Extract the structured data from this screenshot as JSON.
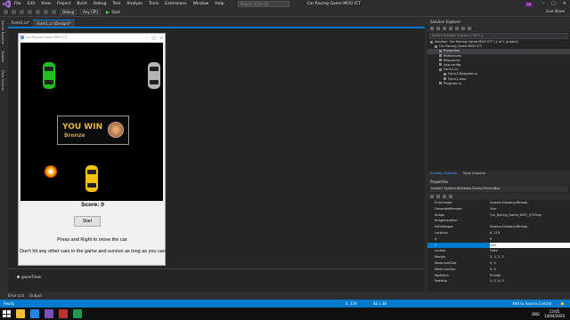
{
  "menu": {
    "items": [
      "File",
      "Edit",
      "View",
      "Project",
      "Build",
      "Debug",
      "Test",
      "Analyze",
      "Tools",
      "Extensions",
      "Window",
      "Help"
    ],
    "search_placeholder": "Search (Ctrl+Q)",
    "project_title": "Car Racing Game MOO ICT",
    "account_badge": "AA"
  },
  "toolbar": {
    "config": "Debug",
    "platform": "Any CPU",
    "start_label": "Start",
    "live_share": "Live Share"
  },
  "left_tabs": [
    "Server Explorer",
    "Toolbox",
    "Data Sources"
  ],
  "doc_tabs": [
    "Form1.cs*",
    "Form1.cs [Design]*"
  ],
  "form": {
    "title": "Car Racing Game MOO ICT",
    "win_text": "YOU WIN",
    "win_sub": "Bronze",
    "score": "Score: 0",
    "start_button": "Start",
    "instr1": "Press and Right to move the car.",
    "instr2": "Don't hit any other cars in the game and survive as long as you can"
  },
  "component_tray": {
    "timer": "gameTimer"
  },
  "solution_explorer": {
    "title": "Solution Explorer",
    "search_placeholder": "Search Solution Explorer (Ctrl+;)",
    "tree": [
      {
        "label": "Solution 'Car Racing Game MOO ICT' (1 of 1 project)",
        "indent": 0
      },
      {
        "label": "Car Racing Game MOO ICT",
        "indent": 1
      },
      {
        "label": "Properties",
        "indent": 2,
        "selected": true
      },
      {
        "label": "References",
        "indent": 2
      },
      {
        "label": "Resources",
        "indent": 2
      },
      {
        "label": "App.config",
        "indent": 2
      },
      {
        "label": "Form1.cs",
        "indent": 2
      },
      {
        "label": "Form1.Designer.cs",
        "indent": 3
      },
      {
        "label": "Form1.resx",
        "indent": 3
      },
      {
        "label": "Program.cs",
        "indent": 2
      }
    ],
    "tabs": [
      "Solution Explorer",
      "Team Explorer"
    ]
  },
  "properties": {
    "title": "Properties",
    "object": "medal2 System.Windows.Forms.PictureBox",
    "rows": [
      {
        "name": "ErrorImage",
        "value": "System.Drawing.Bitmap"
      },
      {
        "name": "GenerateMember",
        "value": "True"
      },
      {
        "name": "Image",
        "value": "Car_Racing_Game_MOO_ICT.Prop"
      },
      {
        "name": "ImageLocation",
        "value": ""
      },
      {
        "name": "InitialImage",
        "value": "System.Drawing.Bitmap"
      },
      {
        "name": "Location",
        "value": "6, 119"
      },
      {
        "name": "X",
        "value": "6"
      },
      {
        "name": "Y",
        "value": "119",
        "selected": true
      },
      {
        "name": "Locked",
        "value": "False"
      },
      {
        "name": "Margin",
        "value": "3, 3, 3, 3"
      },
      {
        "name": "MaximumSize",
        "value": "0, 0"
      },
      {
        "name": "MinimumSize",
        "value": "0, 0"
      },
      {
        "name": "Modifiers",
        "value": "Private"
      },
      {
        "name": "Padding",
        "value": "0, 0, 0, 0"
      }
    ]
  },
  "bottom_tabs": [
    "Error List",
    "Output"
  ],
  "status": {
    "ready": "Ready",
    "position": "6, 119",
    "size": "44 x 38",
    "source_control": "Add to Source Control",
    "language": "ENG",
    "time": "13:05",
    "date": "14/04/2020"
  },
  "colors": {
    "accent": "#007acc",
    "ide_bg": "#2d2d30",
    "game_bg": "#000000"
  }
}
